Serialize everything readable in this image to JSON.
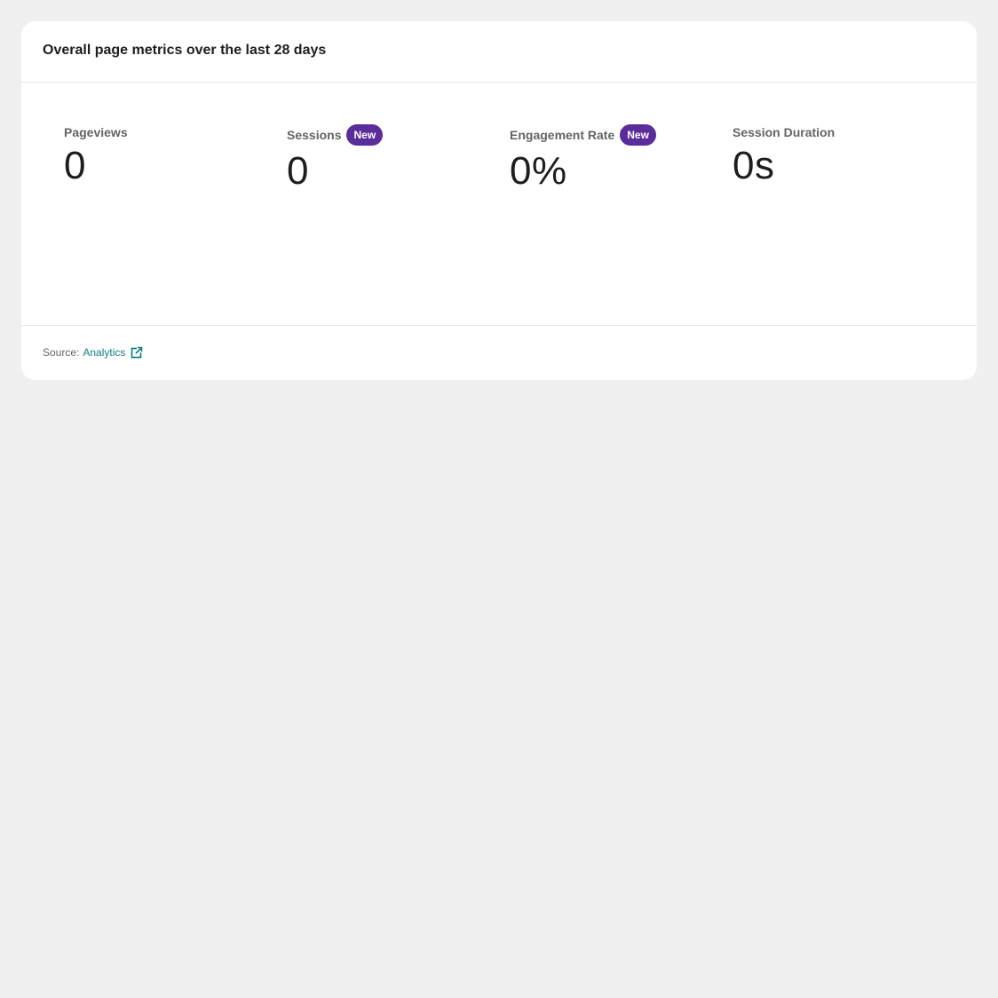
{
  "card": {
    "title": "Overall page metrics over the last 28 days"
  },
  "metrics": [
    {
      "label": "Pageviews",
      "value": "0",
      "badge": ""
    },
    {
      "label": "Sessions",
      "value": "0",
      "badge": "New"
    },
    {
      "label": "Engagement Rate",
      "value": "0%",
      "badge": "New"
    },
    {
      "label": "Session Duration",
      "value": "0s",
      "badge": ""
    }
  ],
  "footer": {
    "source_label": "Source:",
    "source_link": "Analytics",
    "link_icon": "external-link-icon"
  },
  "colors": {
    "badge": "#5b2d9b",
    "link": "#0f7c82",
    "background": "#f0f0f0"
  }
}
